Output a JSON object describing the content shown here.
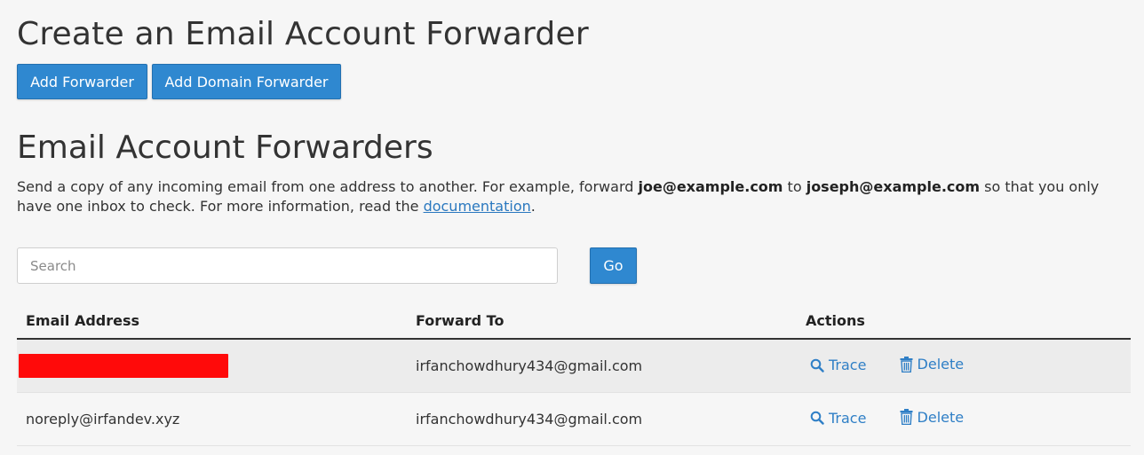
{
  "create_section": {
    "title": "Create an Email Account Forwarder",
    "add_forwarder_label": "Add Forwarder",
    "add_domain_forwarder_label": "Add Domain Forwarder"
  },
  "list_section": {
    "title": "Email Account Forwarders",
    "description": {
      "part1": "Send a copy of any incoming email from one address to another. For example, forward ",
      "example_from": "joe@example.com",
      "part2": " to ",
      "example_to": "joseph@example.com",
      "part3": " so that you only have one inbox to check. For more information, read the ",
      "link_text": "documentation",
      "part4": "."
    }
  },
  "search": {
    "placeholder": "Search",
    "value": "",
    "go_label": "Go"
  },
  "table": {
    "headers": {
      "email": "Email Address",
      "forward_to": "Forward To",
      "actions": "Actions"
    },
    "rows": [
      {
        "email": "",
        "email_redacted": true,
        "forward_to": "irfanchowdhury434@gmail.com",
        "trace_label": "Trace",
        "delete_label": "Delete"
      },
      {
        "email": "noreply@irfandev.xyz",
        "email_redacted": false,
        "forward_to": "irfanchowdhury434@gmail.com",
        "trace_label": "Trace",
        "delete_label": "Delete"
      }
    ]
  },
  "colors": {
    "primary_button": "#2f88d0",
    "link": "#2f7fc6",
    "redaction": "#ff0a0a",
    "background": "#f6f6f6"
  },
  "icons": {
    "trace": "search-icon",
    "delete": "trash-icon"
  }
}
